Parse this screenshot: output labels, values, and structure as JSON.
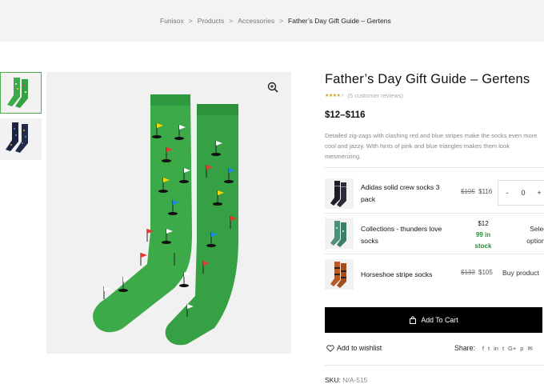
{
  "breadcrumb": {
    "items": [
      "Funisox",
      "Products",
      "Accessories"
    ],
    "separator": ">",
    "current": "Father’s Day Gift Guide – Gertens"
  },
  "gallery": {
    "thumbnails": [
      {
        "icon": "green-golf-socks-thumbnail",
        "active": true
      },
      {
        "icon": "navy-socks-thumbnail",
        "active": false
      }
    ],
    "zoom_icon": "magnifier-plus-icon"
  },
  "product": {
    "title": "Father’s Day Gift Guide – Gertens",
    "rating_value": 3.5,
    "rating_max": 5,
    "reviews": "(5 customer reviews)",
    "price": "$12–$116",
    "description": "Detailed zig-zags with clashing red and blue stripes make the socks even more cool and jazzy. With hints of pink and blue triangles makes them look mesmerizing."
  },
  "bundle": {
    "items": [
      {
        "name": "Adidas solid crew socks 3 pack",
        "old_price": "$195",
        "price": "$116",
        "quantity": "0",
        "minus": "-",
        "plus": "+"
      },
      {
        "name": "Collections - thunders love socks",
        "price": "$12",
        "stock": "99 in stock",
        "action": "Select options"
      },
      {
        "name": "Horseshoe stripe socks",
        "old_price": "$133",
        "price": "$105",
        "action": "Buy product"
      }
    ]
  },
  "actions": {
    "add_to_cart": "Add To Cart",
    "wishlist": "Add to wishlist",
    "share_label": "Share:",
    "share_icons": [
      "f",
      "t",
      "in",
      "t",
      "G+",
      "p",
      "✉"
    ]
  },
  "meta": {
    "sku_label": "SKU:",
    "sku_value": "N/A-515"
  },
  "colors": {
    "sock_green": "#3daa4a",
    "button": "#000000",
    "in_stock": "#2e8b3d",
    "active_thumb_border": "#4caf50"
  }
}
